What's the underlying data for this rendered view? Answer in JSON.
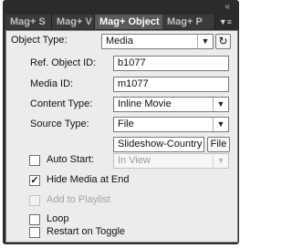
{
  "tabs": [
    {
      "label": "Mag+ S",
      "active": false
    },
    {
      "label": "Mag+ V",
      "active": false
    },
    {
      "label": "Mag+ Object",
      "active": true
    },
    {
      "label": "Mag+ P",
      "active": false
    }
  ],
  "panel_menu_icon": "panel-menu-icon",
  "collapse_icon": "double-chevron-icon",
  "form": {
    "object_type": {
      "label": "Object Type:",
      "value": "Media"
    },
    "ref_object_id": {
      "label": "Ref. Object ID:",
      "value": "b1077"
    },
    "media_id": {
      "label": "Media ID:",
      "value": "m1077"
    },
    "content_type": {
      "label": "Content Type:",
      "value": "Inline Movie"
    },
    "source_type": {
      "label": "Source Type:",
      "value": "File"
    },
    "source_file": {
      "value": "Slideshow-Country",
      "button_label": "File"
    },
    "auto_start": {
      "label": "Auto Start:",
      "checked": false,
      "select_value": "In View"
    },
    "hide_media_at_end": {
      "label": "Hide Media at End",
      "checked": true
    },
    "add_to_playlist": {
      "label": "Add to Playlist",
      "checked": false,
      "disabled": true
    },
    "loop": {
      "label": "Loop",
      "checked": false
    },
    "restart_on_toggle": {
      "label": "Restart on Toggle",
      "checked": false
    }
  },
  "colors": {
    "panel_header": "#2b2b2b",
    "panel_body": "#ececec",
    "tab_active": "#5a5a5a"
  }
}
